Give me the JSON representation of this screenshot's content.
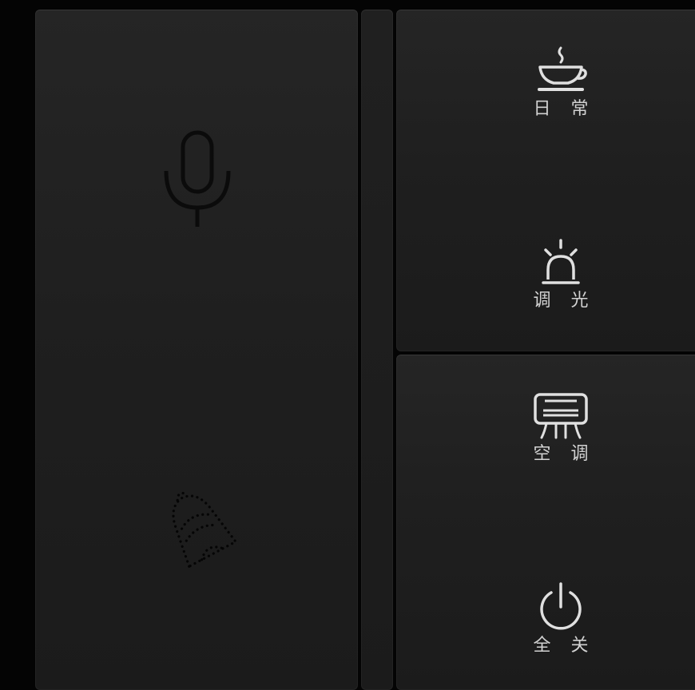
{
  "left_panel": {
    "mic_icon": "microphone-icon",
    "bell_icon": "dotted-bell-icon"
  },
  "scene_buttons": [
    {
      "id": "daily",
      "label": "日 常",
      "icon": "teacup-icon"
    },
    {
      "id": "dim",
      "label": "调 光",
      "icon": "lamp-icon"
    },
    {
      "id": "ac",
      "label": "空 调",
      "icon": "air-conditioner-icon"
    },
    {
      "id": "off",
      "label": "全 关",
      "icon": "power-icon"
    }
  ],
  "colors": {
    "background": "#040404",
    "panel": "#222222",
    "icon_dark": "#0b0b0b",
    "icon_light": "#e0e0e0",
    "label": "#d2d2d2"
  }
}
